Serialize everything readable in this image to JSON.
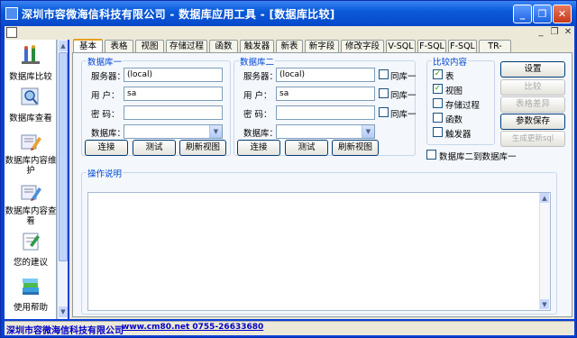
{
  "window": {
    "title": "深圳市容微海信科技有限公司 - 数据库应用工具 - [数据库比较]",
    "minimize": "_",
    "restore": "❐",
    "close": "✕"
  },
  "mdi": {
    "minimize": "_",
    "restore": "❐",
    "close": "✕"
  },
  "sidebar": {
    "items": [
      {
        "label": "数据库比较",
        "icon": "compare-icon"
      },
      {
        "label": "数据库查看",
        "icon": "magnifier-icon"
      },
      {
        "label": "数据库内容维护",
        "icon": "edit-pencil-icon"
      },
      {
        "label": "数据库内容查看",
        "icon": "view-pencil-icon"
      },
      {
        "label": "您的建议",
        "icon": "feedback-icon"
      },
      {
        "label": "使用帮助",
        "icon": "help-books-icon"
      }
    ]
  },
  "tabs": [
    "基本",
    "表格",
    "视图",
    "存储过程",
    "函数",
    "触发器",
    "新表",
    "新字段",
    "修改字段",
    "V-SQL",
    "F-SQL",
    "F-SQL",
    "TR-SQL"
  ],
  "db1": {
    "title": "数据库一",
    "server_label": "服务器：",
    "server_value": "(local)",
    "user_label": "用  户：",
    "user_value": "sa",
    "password_label": "密  码：",
    "password_value": "",
    "database_label": "数据库：",
    "database_value": "",
    "connect": "连接",
    "test": "测试",
    "refresh": "刷新视图"
  },
  "db2": {
    "title": "数据库二",
    "server_label": "服务器：",
    "server_value": "(local)",
    "user_label": "用  户：",
    "user_value": "sa",
    "password_label": "密  码：",
    "password_value": "",
    "database_label": "数据库：",
    "database_value": "",
    "same1": "同库一",
    "same2": "同库一",
    "same3": "同库一",
    "connect": "连接",
    "test": "测试",
    "refresh": "刷新视图"
  },
  "compare": {
    "title": "比较内容",
    "items": [
      {
        "label": "表",
        "checked": true
      },
      {
        "label": "视图",
        "checked": true
      },
      {
        "label": "存储过程",
        "checked": false
      },
      {
        "label": "函数",
        "checked": false
      },
      {
        "label": "触发器",
        "checked": false
      }
    ],
    "db2_to_db1": "数据库二到数据库一"
  },
  "actions": {
    "settings": "设置",
    "compare": "比较",
    "table_diff": "表格差异",
    "save_params": "参数保存",
    "generate_sql": "生成更新sql"
  },
  "instructions": {
    "title": "操作说明",
    "content": ""
  },
  "status": {
    "company": "深圳市容微海信科技有限公司",
    "contact": "www.cm80.net  0755-26633680"
  }
}
